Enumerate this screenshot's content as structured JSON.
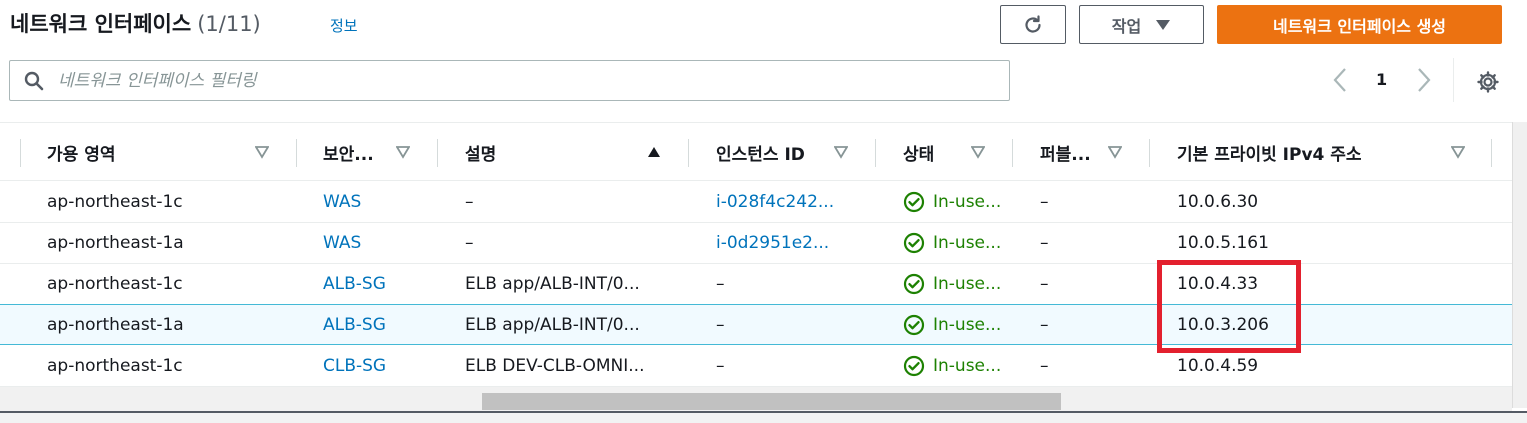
{
  "header": {
    "title": "네트워크 인터페이스",
    "count": "(1/11)",
    "info_link": "정보",
    "actions_label": "작업",
    "create_label": "네트워크 인터페이스 생성"
  },
  "search": {
    "placeholder": "네트워크 인터페이스 필터링"
  },
  "pagination": {
    "current_page": "1"
  },
  "table": {
    "columns": [
      {
        "label": "가용 영역"
      },
      {
        "label": "보안..."
      },
      {
        "label": "설명"
      },
      {
        "label": "인스턴스 ID"
      },
      {
        "label": "상태"
      },
      {
        "label": "퍼블..."
      },
      {
        "label": "기본 프라이빗 IPv4 주소"
      }
    ],
    "rows": [
      {
        "az": "ap-northeast-1c",
        "sg": "WAS",
        "desc": "–",
        "instance": "i-028f4c242...",
        "status": "In-use...",
        "public": "–",
        "ipv4": "10.0.6.30"
      },
      {
        "az": "ap-northeast-1a",
        "sg": "WAS",
        "desc": "–",
        "instance": "i-0d2951e2...",
        "status": "In-use...",
        "public": "–",
        "ipv4": "10.0.5.161"
      },
      {
        "az": "ap-northeast-1c",
        "sg": "ALB-SG",
        "desc": "ELB app/ALB-INT/0...",
        "instance": "–",
        "status": "In-use...",
        "public": "–",
        "ipv4": "10.0.4.33"
      },
      {
        "az": "ap-northeast-1a",
        "sg": "ALB-SG",
        "desc": "ELB app/ALB-INT/0...",
        "instance": "–",
        "status": "In-use...",
        "public": "–",
        "ipv4": "10.0.3.206"
      },
      {
        "az": "ap-northeast-1c",
        "sg": "CLB-SG",
        "desc": "ELB DEV-CLB-OMNI...",
        "instance": "–",
        "status": "In-use...",
        "public": "–",
        "ipv4": "10.0.4.59"
      }
    ]
  },
  "colors": {
    "accent": "#ec7211",
    "link": "#0073bb",
    "status_ok": "#1d8102",
    "selected_row": "#f1faff",
    "highlight": "#e3202e"
  }
}
